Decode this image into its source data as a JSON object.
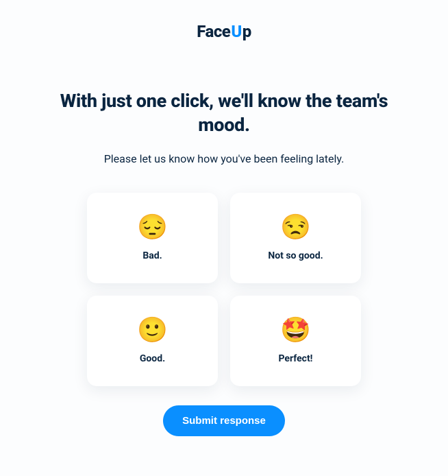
{
  "brand": {
    "logo_face": "Face",
    "logo_u": "U",
    "logo_p": "p"
  },
  "headline": "With just one click, we'll know the team's mood.",
  "subtitle": "Please let us know how you've been feeling lately.",
  "options": [
    {
      "emoji": "😔",
      "label": "Bad."
    },
    {
      "emoji": "😒",
      "label": "Not so good."
    },
    {
      "emoji": "🙂",
      "label": "Good."
    },
    {
      "emoji": "🤩",
      "label": "Perfect!"
    }
  ],
  "submit_label": "Submit response"
}
